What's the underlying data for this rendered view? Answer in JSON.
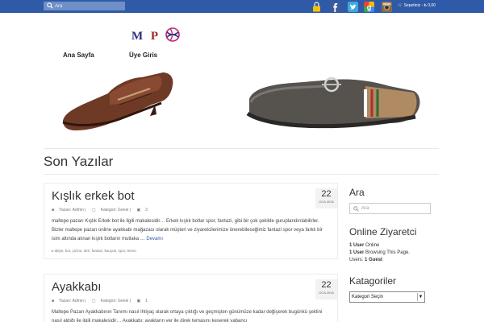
{
  "topbar": {
    "search_placeholder": "Ara",
    "cart_text": "Sepetiniz - ₺ 0,00",
    "social_icons": [
      "lock-icon",
      "facebook-icon",
      "twitter-icon",
      "google-plus-icon",
      "instagram-icon"
    ],
    "bar_color": "#2f5aa8"
  },
  "header": {
    "logo_letters": [
      "M",
      "P"
    ],
    "nav": [
      "Ana Sayfa",
      "Üye Giris"
    ]
  },
  "main": {
    "page_title": "Son Yazılar",
    "posts": [
      {
        "title": "Kışlık erkek bot",
        "day": "22",
        "month_year": "OCA 2016",
        "author": "Yazarı: Admin |",
        "category": "Kategori: Genel |",
        "comments": "3",
        "excerpt": "maltepe pazarı Kışlık Erkek bot ile ilgili makalesidir… Erkek kışlık botlar spor, fantazi, gibi bir çok şekilde guruplandırılabilirler. Bizler maltepe pazarı online ayakkabı mağazası olarak müşteri ve ziyaretcilerimize önerebileceğimiz fantazi spor veya farklı bir isim altında alınan kışlık botların mutlaka …",
        "more": "Devamı",
        "tags": "abiye, bot, çizme, deri, fantazi, kauçuk, spor, termo"
      },
      {
        "title": "Ayakkabı",
        "day": "22",
        "month_year": "OCA 2016",
        "author": "Yazarı: Admin |",
        "category": "Kategori: Genel |",
        "comments": "1",
        "excerpt": "Maltepe Pazarı  Ayakkabının Tanımı nasıl ihtiyaç olarak ortaya çıktığı ve geçmişten günümüze kadar değişerek bugünkü şeklini nasıl aldığı ile ilgili makalesidir… Ayakkabı; ayakların yer ile direk temasını keserek yabancı"
      }
    ]
  },
  "sidebar": {
    "search_title": "Ara",
    "search_placeholder": "Ara",
    "online_title": "Online Ziyaretci",
    "online_line1_bold": "1 User",
    "online_line1_rest": " Online",
    "online_line2_bold": "1 User",
    "online_line2_rest": " Browsing This Page.",
    "online_line3_prefix": "Users: ",
    "online_line3_bold": "1 Guest",
    "categories_title": "Katagoriler",
    "categories_select": "Kategori Seçin"
  }
}
